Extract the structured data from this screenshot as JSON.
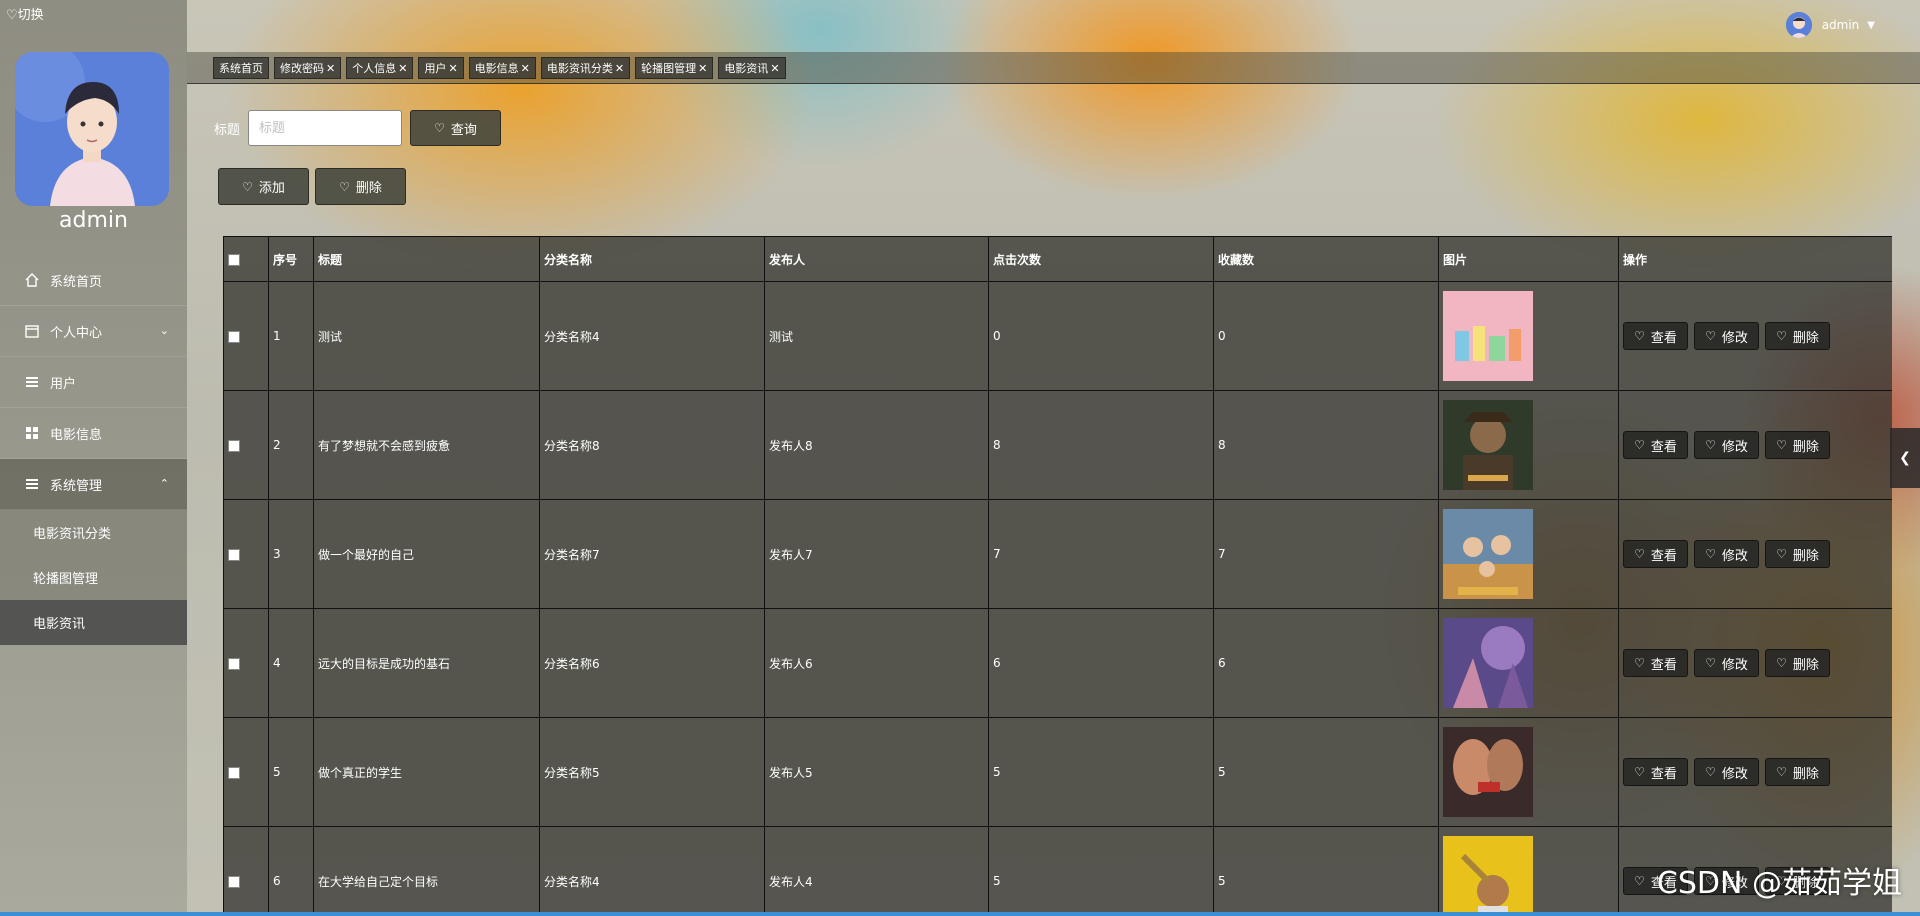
{
  "sidebar": {
    "switch_label": "♡切换",
    "username": "admin",
    "menu": [
      {
        "label": "系统首页",
        "icon": "home-icon"
      },
      {
        "label": "个人中心",
        "icon": "calendar-icon"
      },
      {
        "label": "用户",
        "icon": "list-icon"
      },
      {
        "label": "电影信息",
        "icon": "grid-icon"
      },
      {
        "label": "系统管理",
        "icon": "list-icon"
      }
    ],
    "submenu": [
      "电影资讯分类",
      "轮播图管理",
      "电影资讯"
    ]
  },
  "header": {
    "user": "admin",
    "tags": [
      "系统首页",
      "修改密码",
      "个人信息",
      "用户",
      "电影信息",
      "电影资讯分类",
      "轮播图管理",
      "电影资讯"
    ]
  },
  "search": {
    "label": "标题",
    "placeholder": "标题",
    "query_label": "查询"
  },
  "actions": {
    "add_label": "添加",
    "delete_label": "删除"
  },
  "table": {
    "headers": [
      "序号",
      "标题",
      "分类名称",
      "发布人",
      "点击次数",
      "收藏数",
      "图片",
      "操作"
    ],
    "rows": [
      {
        "no": "1",
        "title": "测试",
        "category": "分类名称4",
        "publisher": "测试",
        "clicks": "0",
        "favorites": "0"
      },
      {
        "no": "2",
        "title": "有了梦想就不会感到疲惫",
        "category": "分类名称8",
        "publisher": "发布人8",
        "clicks": "8",
        "favorites": "8"
      },
      {
        "no": "3",
        "title": "做一个最好的自己",
        "category": "分类名称7",
        "publisher": "发布人7",
        "clicks": "7",
        "favorites": "7"
      },
      {
        "no": "4",
        "title": "远大的目标是成功的基石",
        "category": "分类名称6",
        "publisher": "发布人6",
        "clicks": "6",
        "favorites": "6"
      },
      {
        "no": "5",
        "title": "做个真正的学生",
        "category": "分类名称5",
        "publisher": "发布人5",
        "clicks": "5",
        "favorites": "5"
      },
      {
        "no": "6",
        "title": "在大学给自己定个目标",
        "category": "分类名称4",
        "publisher": "发布人4",
        "clicks": "5",
        "favorites": "5"
      }
    ],
    "op_view": "查看",
    "op_edit": "修改",
    "op_delete": "删除"
  },
  "watermark": "CSDN @茹茹学姐",
  "colors": {
    "sidebar_current": "#464848",
    "accent_bottom": "#3b8fd6"
  }
}
